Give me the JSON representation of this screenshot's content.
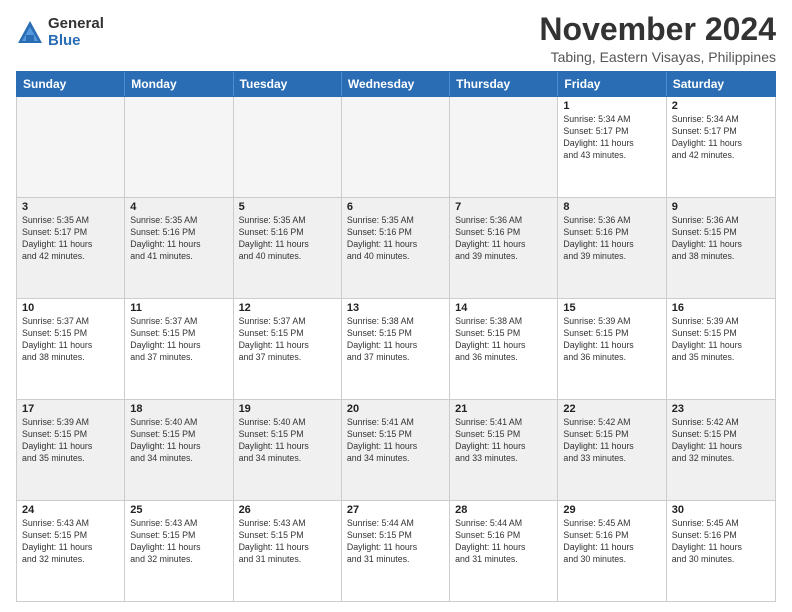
{
  "logo": {
    "general": "General",
    "blue": "Blue"
  },
  "title": "November 2024",
  "subtitle": "Tabing, Eastern Visayas, Philippines",
  "days_of_week": [
    "Sunday",
    "Monday",
    "Tuesday",
    "Wednesday",
    "Thursday",
    "Friday",
    "Saturday"
  ],
  "weeks": [
    [
      {
        "day": "",
        "empty": true
      },
      {
        "day": "",
        "empty": true
      },
      {
        "day": "",
        "empty": true
      },
      {
        "day": "",
        "empty": true
      },
      {
        "day": "",
        "empty": true
      },
      {
        "day": "1",
        "info": "Sunrise: 5:34 AM\nSunset: 5:17 PM\nDaylight: 11 hours\nand 43 minutes."
      },
      {
        "day": "2",
        "info": "Sunrise: 5:34 AM\nSunset: 5:17 PM\nDaylight: 11 hours\nand 42 minutes."
      }
    ],
    [
      {
        "day": "3",
        "info": "Sunrise: 5:35 AM\nSunset: 5:17 PM\nDaylight: 11 hours\nand 42 minutes."
      },
      {
        "day": "4",
        "info": "Sunrise: 5:35 AM\nSunset: 5:16 PM\nDaylight: 11 hours\nand 41 minutes."
      },
      {
        "day": "5",
        "info": "Sunrise: 5:35 AM\nSunset: 5:16 PM\nDaylight: 11 hours\nand 40 minutes."
      },
      {
        "day": "6",
        "info": "Sunrise: 5:35 AM\nSunset: 5:16 PM\nDaylight: 11 hours\nand 40 minutes."
      },
      {
        "day": "7",
        "info": "Sunrise: 5:36 AM\nSunset: 5:16 PM\nDaylight: 11 hours\nand 39 minutes."
      },
      {
        "day": "8",
        "info": "Sunrise: 5:36 AM\nSunset: 5:16 PM\nDaylight: 11 hours\nand 39 minutes."
      },
      {
        "day": "9",
        "info": "Sunrise: 5:36 AM\nSunset: 5:15 PM\nDaylight: 11 hours\nand 38 minutes."
      }
    ],
    [
      {
        "day": "10",
        "info": "Sunrise: 5:37 AM\nSunset: 5:15 PM\nDaylight: 11 hours\nand 38 minutes."
      },
      {
        "day": "11",
        "info": "Sunrise: 5:37 AM\nSunset: 5:15 PM\nDaylight: 11 hours\nand 37 minutes."
      },
      {
        "day": "12",
        "info": "Sunrise: 5:37 AM\nSunset: 5:15 PM\nDaylight: 11 hours\nand 37 minutes."
      },
      {
        "day": "13",
        "info": "Sunrise: 5:38 AM\nSunset: 5:15 PM\nDaylight: 11 hours\nand 37 minutes."
      },
      {
        "day": "14",
        "info": "Sunrise: 5:38 AM\nSunset: 5:15 PM\nDaylight: 11 hours\nand 36 minutes."
      },
      {
        "day": "15",
        "info": "Sunrise: 5:39 AM\nSunset: 5:15 PM\nDaylight: 11 hours\nand 36 minutes."
      },
      {
        "day": "16",
        "info": "Sunrise: 5:39 AM\nSunset: 5:15 PM\nDaylight: 11 hours\nand 35 minutes."
      }
    ],
    [
      {
        "day": "17",
        "info": "Sunrise: 5:39 AM\nSunset: 5:15 PM\nDaylight: 11 hours\nand 35 minutes."
      },
      {
        "day": "18",
        "info": "Sunrise: 5:40 AM\nSunset: 5:15 PM\nDaylight: 11 hours\nand 34 minutes."
      },
      {
        "day": "19",
        "info": "Sunrise: 5:40 AM\nSunset: 5:15 PM\nDaylight: 11 hours\nand 34 minutes."
      },
      {
        "day": "20",
        "info": "Sunrise: 5:41 AM\nSunset: 5:15 PM\nDaylight: 11 hours\nand 34 minutes."
      },
      {
        "day": "21",
        "info": "Sunrise: 5:41 AM\nSunset: 5:15 PM\nDaylight: 11 hours\nand 33 minutes."
      },
      {
        "day": "22",
        "info": "Sunrise: 5:42 AM\nSunset: 5:15 PM\nDaylight: 11 hours\nand 33 minutes."
      },
      {
        "day": "23",
        "info": "Sunrise: 5:42 AM\nSunset: 5:15 PM\nDaylight: 11 hours\nand 32 minutes."
      }
    ],
    [
      {
        "day": "24",
        "info": "Sunrise: 5:43 AM\nSunset: 5:15 PM\nDaylight: 11 hours\nand 32 minutes."
      },
      {
        "day": "25",
        "info": "Sunrise: 5:43 AM\nSunset: 5:15 PM\nDaylight: 11 hours\nand 32 minutes."
      },
      {
        "day": "26",
        "info": "Sunrise: 5:43 AM\nSunset: 5:15 PM\nDaylight: 11 hours\nand 31 minutes."
      },
      {
        "day": "27",
        "info": "Sunrise: 5:44 AM\nSunset: 5:15 PM\nDaylight: 11 hours\nand 31 minutes."
      },
      {
        "day": "28",
        "info": "Sunrise: 5:44 AM\nSunset: 5:16 PM\nDaylight: 11 hours\nand 31 minutes."
      },
      {
        "day": "29",
        "info": "Sunrise: 5:45 AM\nSunset: 5:16 PM\nDaylight: 11 hours\nand 30 minutes."
      },
      {
        "day": "30",
        "info": "Sunrise: 5:45 AM\nSunset: 5:16 PM\nDaylight: 11 hours\nand 30 minutes."
      }
    ]
  ]
}
